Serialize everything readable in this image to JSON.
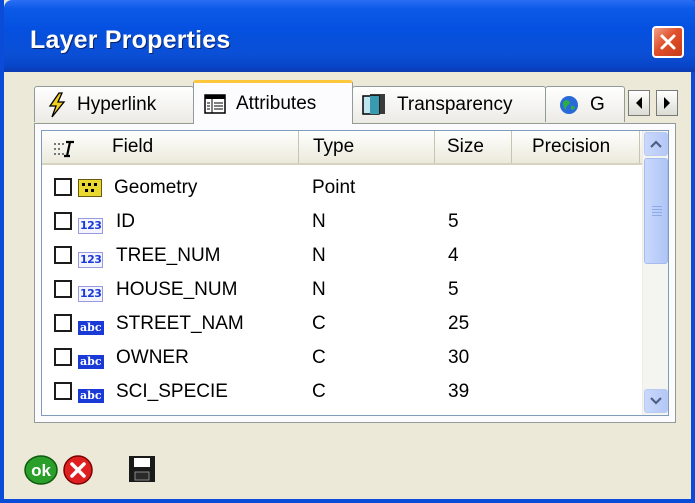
{
  "window": {
    "title": "Layer Properties"
  },
  "tabs": [
    {
      "label": "Hyperlink",
      "icon": "lightning-icon"
    },
    {
      "label": "Attributes",
      "icon": "table-icon",
      "active": true
    },
    {
      "label": "Transparency",
      "icon": "transparency-icon"
    },
    {
      "label": "G",
      "icon": "globe-icon"
    }
  ],
  "columns": {
    "field": "Field",
    "type": "Type",
    "size": "Size",
    "precision": "Precision"
  },
  "rows": [
    {
      "name": "Geometry",
      "type": "Point",
      "size": "",
      "icon": "geometry",
      "checked": false
    },
    {
      "name": "ID",
      "type": "N",
      "size": "5",
      "icon": "123",
      "checked": false
    },
    {
      "name": "TREE_NUM",
      "type": "N",
      "size": "4",
      "icon": "123",
      "checked": false
    },
    {
      "name": "HOUSE_NUM",
      "type": "N",
      "size": "5",
      "icon": "123",
      "checked": false
    },
    {
      "name": "STREET_NAM",
      "type": "C",
      "size": "25",
      "icon": "abc",
      "checked": false
    },
    {
      "name": "OWNER",
      "type": "C",
      "size": "30",
      "icon": "abc",
      "checked": false
    },
    {
      "name": "SCI_SPECIE",
      "type": "C",
      "size": "39",
      "icon": "abc",
      "checked": false
    }
  ],
  "icon_text": {
    "numeric": "123",
    "character": "abc"
  },
  "buttons": {
    "ok_label": "ok"
  },
  "colors": {
    "titlebar": "#0550e0",
    "close": "#e0502a",
    "active_tab_accent": "#ffc83c",
    "numeric_badge": "#1a3ad8",
    "ok_green": "#2aa02a",
    "cancel_red": "#e02020"
  }
}
